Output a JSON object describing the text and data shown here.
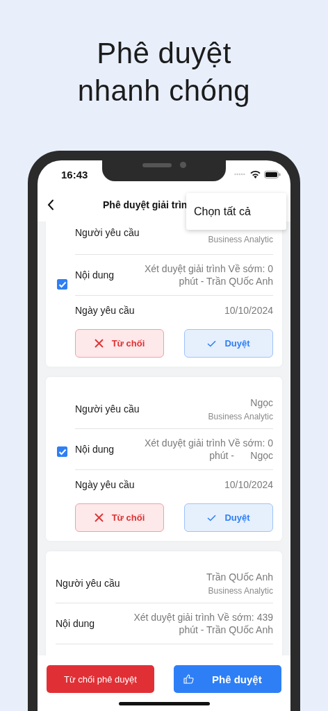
{
  "headline": "Phê duyệt\nnhanh chóng",
  "status_bar": {
    "time": "16:43"
  },
  "nav": {
    "title": "Phê duyệt giải trìn"
  },
  "menu": {
    "items": [
      "Chọn tất cả"
    ]
  },
  "cards": [
    {
      "selectable": true,
      "checked": true,
      "cut_top": true,
      "rows": [
        {
          "kind": "requester",
          "label": "Người yêu cầu",
          "role": "Business Analytic"
        },
        {
          "kind": "content",
          "label": "Nội dung",
          "value": "Xét duyệt giải trình Về sớm: 0 phút - Trần QUốc Anh"
        },
        {
          "kind": "date",
          "label": "Ngày yêu cầu",
          "value": "10/10/2024"
        }
      ],
      "buttons": {
        "reject": "Từ chối",
        "approve": "Duyệt"
      }
    },
    {
      "selectable": true,
      "checked": true,
      "cut_top": false,
      "rows": [
        {
          "kind": "requester",
          "label": "Người yêu cầu",
          "value": "Ngọc",
          "role": "Business Analytic"
        },
        {
          "kind": "content",
          "label": "Nội dung",
          "value": "Xét duyệt giải trình Về sớm: 0 phút -      Ngọc"
        },
        {
          "kind": "date",
          "label": "Ngày yêu cầu",
          "value": "10/10/2024"
        }
      ],
      "buttons": {
        "reject": "Từ chối",
        "approve": "Duyệt"
      }
    },
    {
      "selectable": false,
      "cut_top": false,
      "rows": [
        {
          "kind": "requester",
          "label": "Người yêu cầu",
          "value": "Trần QUốc Anh",
          "role": "Business Analytic"
        },
        {
          "kind": "content",
          "label": "Nội dung",
          "value": "Xét duyệt giải trình Về sớm: 439 phút - Trần QUốc Anh"
        }
      ]
    }
  ],
  "bottom_bar": {
    "reject": "Từ chối phê duyệt",
    "approve": "Phê duyệt"
  }
}
